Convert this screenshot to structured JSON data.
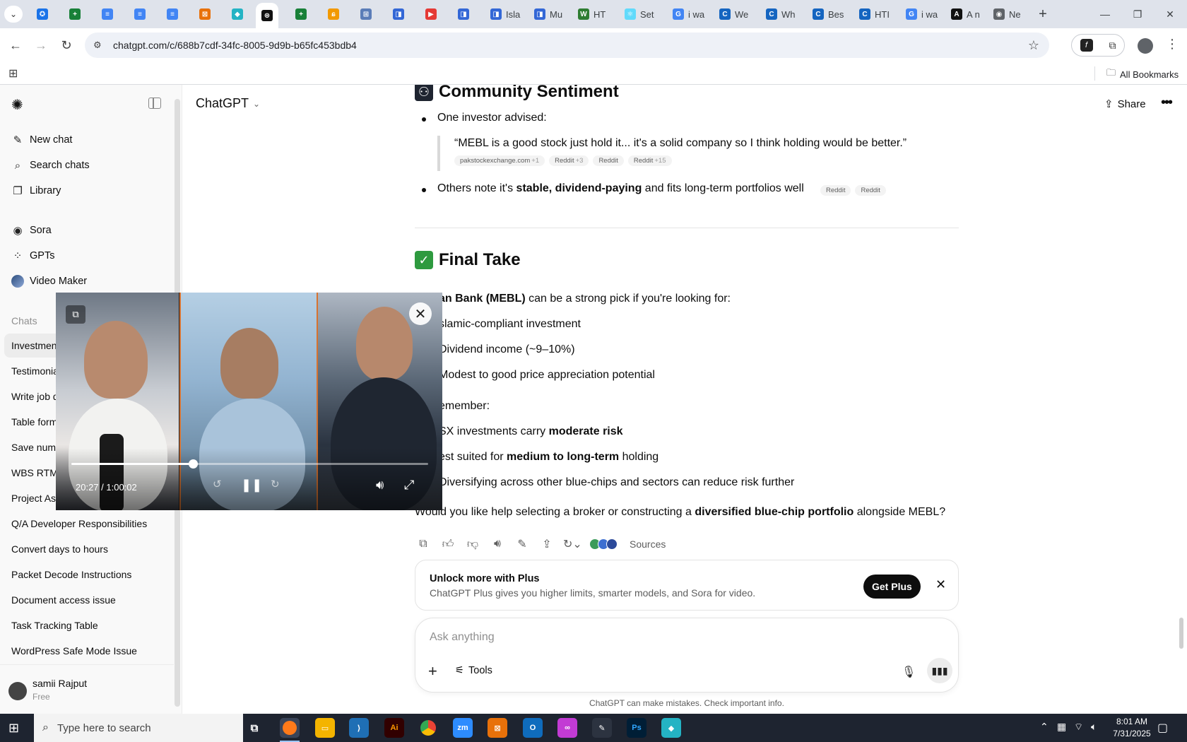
{
  "browser": {
    "tabs": [
      {
        "label": "",
        "color": "#1a73e8",
        "glyph": "✪"
      },
      {
        "label": "",
        "color": "#188038",
        "glyph": "+"
      },
      {
        "label": "",
        "color": "#4285f4",
        "glyph": "≡"
      },
      {
        "label": "",
        "color": "#4285f4",
        "glyph": "≡"
      },
      {
        "label": "",
        "color": "#4285f4",
        "glyph": "≡"
      },
      {
        "label": "",
        "color": "#e8710a",
        "glyph": "⊠"
      },
      {
        "label": "",
        "color": "#24b3c4",
        "glyph": "◆"
      },
      {
        "label": "",
        "color": "#111111",
        "glyph": "⊛",
        "active": true
      },
      {
        "label": "",
        "color": "#188038",
        "glyph": "+"
      },
      {
        "label": "",
        "color": "#f29900",
        "glyph": "ɕ"
      },
      {
        "label": "",
        "color": "#5b7db8",
        "glyph": "⊞"
      },
      {
        "label": "",
        "color": "#3367d6",
        "glyph": "◨"
      },
      {
        "label": "",
        "color": "#e53935",
        "glyph": "▶"
      },
      {
        "label": "",
        "color": "#3367d6",
        "glyph": "◨"
      },
      {
        "label": "Isla",
        "color": "#3367d6",
        "glyph": "◨"
      },
      {
        "label": "Mu",
        "color": "#3367d6",
        "glyph": "◨"
      },
      {
        "label": "HT",
        "color": "#2e7d32",
        "glyph": "W"
      },
      {
        "label": "Set",
        "color": "#61dafb",
        "glyph": "⚛"
      },
      {
        "label": "i wa",
        "color": "#4285f4",
        "glyph": "G"
      },
      {
        "label": "We",
        "color": "#1565c0",
        "glyph": "C"
      },
      {
        "label": "Wh",
        "color": "#1565c0",
        "glyph": "C"
      },
      {
        "label": "Bes",
        "color": "#1565c0",
        "glyph": "C"
      },
      {
        "label": "HTI",
        "color": "#1565c0",
        "glyph": "C"
      },
      {
        "label": "i wa",
        "color": "#4285f4",
        "glyph": "G"
      },
      {
        "label": "A n",
        "color": "#111111",
        "glyph": "A"
      },
      {
        "label": "Ne",
        "color": "#5f6368",
        "glyph": "◉"
      }
    ],
    "url": "chatgpt.com/c/688b7cdf-34fc-8005-9d9b-b65fc453bdb4",
    "all_bookmarks": "All Bookmarks"
  },
  "sidebar": {
    "nav": [
      {
        "label": "New chat",
        "icon": "✎",
        "name": "sidebar-new-chat"
      },
      {
        "label": "Search chats",
        "icon": "⌕",
        "name": "sidebar-search-chats"
      },
      {
        "label": "Library",
        "icon": "❐",
        "name": "sidebar-library"
      },
      {
        "label": "Sora",
        "icon": "◉",
        "name": "sidebar-sora"
      },
      {
        "label": "GPTs",
        "icon": "⁘",
        "name": "sidebar-gpts"
      },
      {
        "label": "Video Maker",
        "icon": "",
        "name": "sidebar-video-maker"
      }
    ],
    "chats_header": "Chats",
    "chats": [
      "Investment",
      "Testimonial",
      "Write job d",
      "Table form",
      "Save numb",
      "WBS RTM",
      "Project As",
      "Q/A Developer Responsibilities",
      "Convert days to hours",
      "Packet Decode Instructions",
      "Document access issue",
      "Task Tracking Table",
      "WordPress Safe Mode Issue"
    ],
    "user": {
      "name": "samii Rajput",
      "plan": "Free"
    }
  },
  "header": {
    "model": "ChatGPT",
    "share": "Share"
  },
  "message": {
    "community_heading": "Community Sentiment",
    "bullet1_lead": "One investor advised:",
    "quote": "“MEBL is a good stock just hold it... it's a solid company so I think holding would be better.”",
    "quote_sources": [
      {
        "label": "pakstockexchange.com",
        "count": "+1"
      },
      {
        "label": "Reddit",
        "count": "+3"
      },
      {
        "label": "Reddit",
        "count": ""
      },
      {
        "label": "Reddit",
        "count": "+15"
      }
    ],
    "bullet2_pre": "Others note it's ",
    "bullet2_bold": "stable, dividend-paying",
    "bullet2_post": " and fits long-term portfolios well",
    "bullet2_sources": [
      "Reddit",
      "Reddit"
    ],
    "final_heading": "Final Take",
    "final_lead_bold": "an Bank (MEBL)",
    "final_lead_post": " can be a strong pick if you're looking for:",
    "list1": [
      "slamic-compliant investment",
      "Dividend income (~9–10%)",
      "Modest to good price appreciation potential"
    ],
    "remember": "emember:",
    "r1_pre": "SX investments carry ",
    "r1_bold": "moderate risk",
    "r2_pre": "est suited for ",
    "r2_bold": "medium to long-term",
    "r2_post": " holding",
    "r3": "Diversifying across other blue-chips and sectors can reduce risk further",
    "closing_pre": "Would you like help selecting a broker or constructing a ",
    "closing_bold": "diversified blue-chip portfolio",
    "closing_post": " alongside MEBL?",
    "sources_label": "Sources"
  },
  "upsell": {
    "title": "Unlock more with Plus",
    "body": "ChatGPT Plus gives you higher limits, smarter models, and Sora for video.",
    "button": "Get Plus"
  },
  "composer": {
    "placeholder": "Ask anything",
    "tools": "Tools"
  },
  "disclaimer": "ChatGPT can make mistakes. Check important info.",
  "video": {
    "time": "20:27 / 1:00:02",
    "progress": 0.34
  },
  "taskbar": {
    "search_placeholder": "Type here to search",
    "time": "8:01 AM",
    "date": "7/31/2025"
  },
  "colors": {
    "accent_orange": "#d7722f",
    "check_green": "#2e9a3f",
    "sidebar_bg": "#f9f9f9"
  }
}
